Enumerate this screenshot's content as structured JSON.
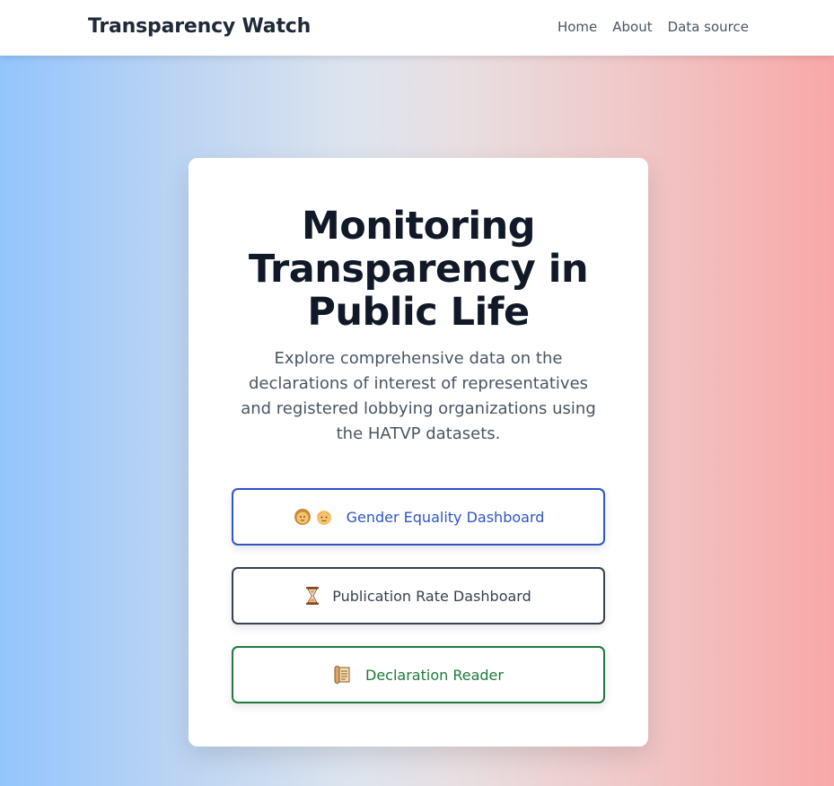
{
  "navbar": {
    "brand": "Transparency Watch",
    "links": [
      "Home",
      "About",
      "Data source"
    ]
  },
  "hero": {
    "title": "Monitoring Transparency in Public Life",
    "subtitle": "Explore comprehensive data on the declarations of interest of representatives and registered lobbying organizations using the HATVP datasets."
  },
  "buttons": [
    {
      "label": "Gender Equality Dashboard",
      "icon": "woman-man-emoji-icon",
      "color": "#2f55c8"
    },
    {
      "label": "Publication Rate Dashboard",
      "icon": "hourglass-icon",
      "color": "#374151"
    },
    {
      "label": "Declaration Reader",
      "icon": "scroll-icon",
      "color": "#1f7a3c"
    }
  ],
  "colors": {
    "gradient_left": "#93c5fd",
    "gradient_right": "#f9a8a8"
  }
}
